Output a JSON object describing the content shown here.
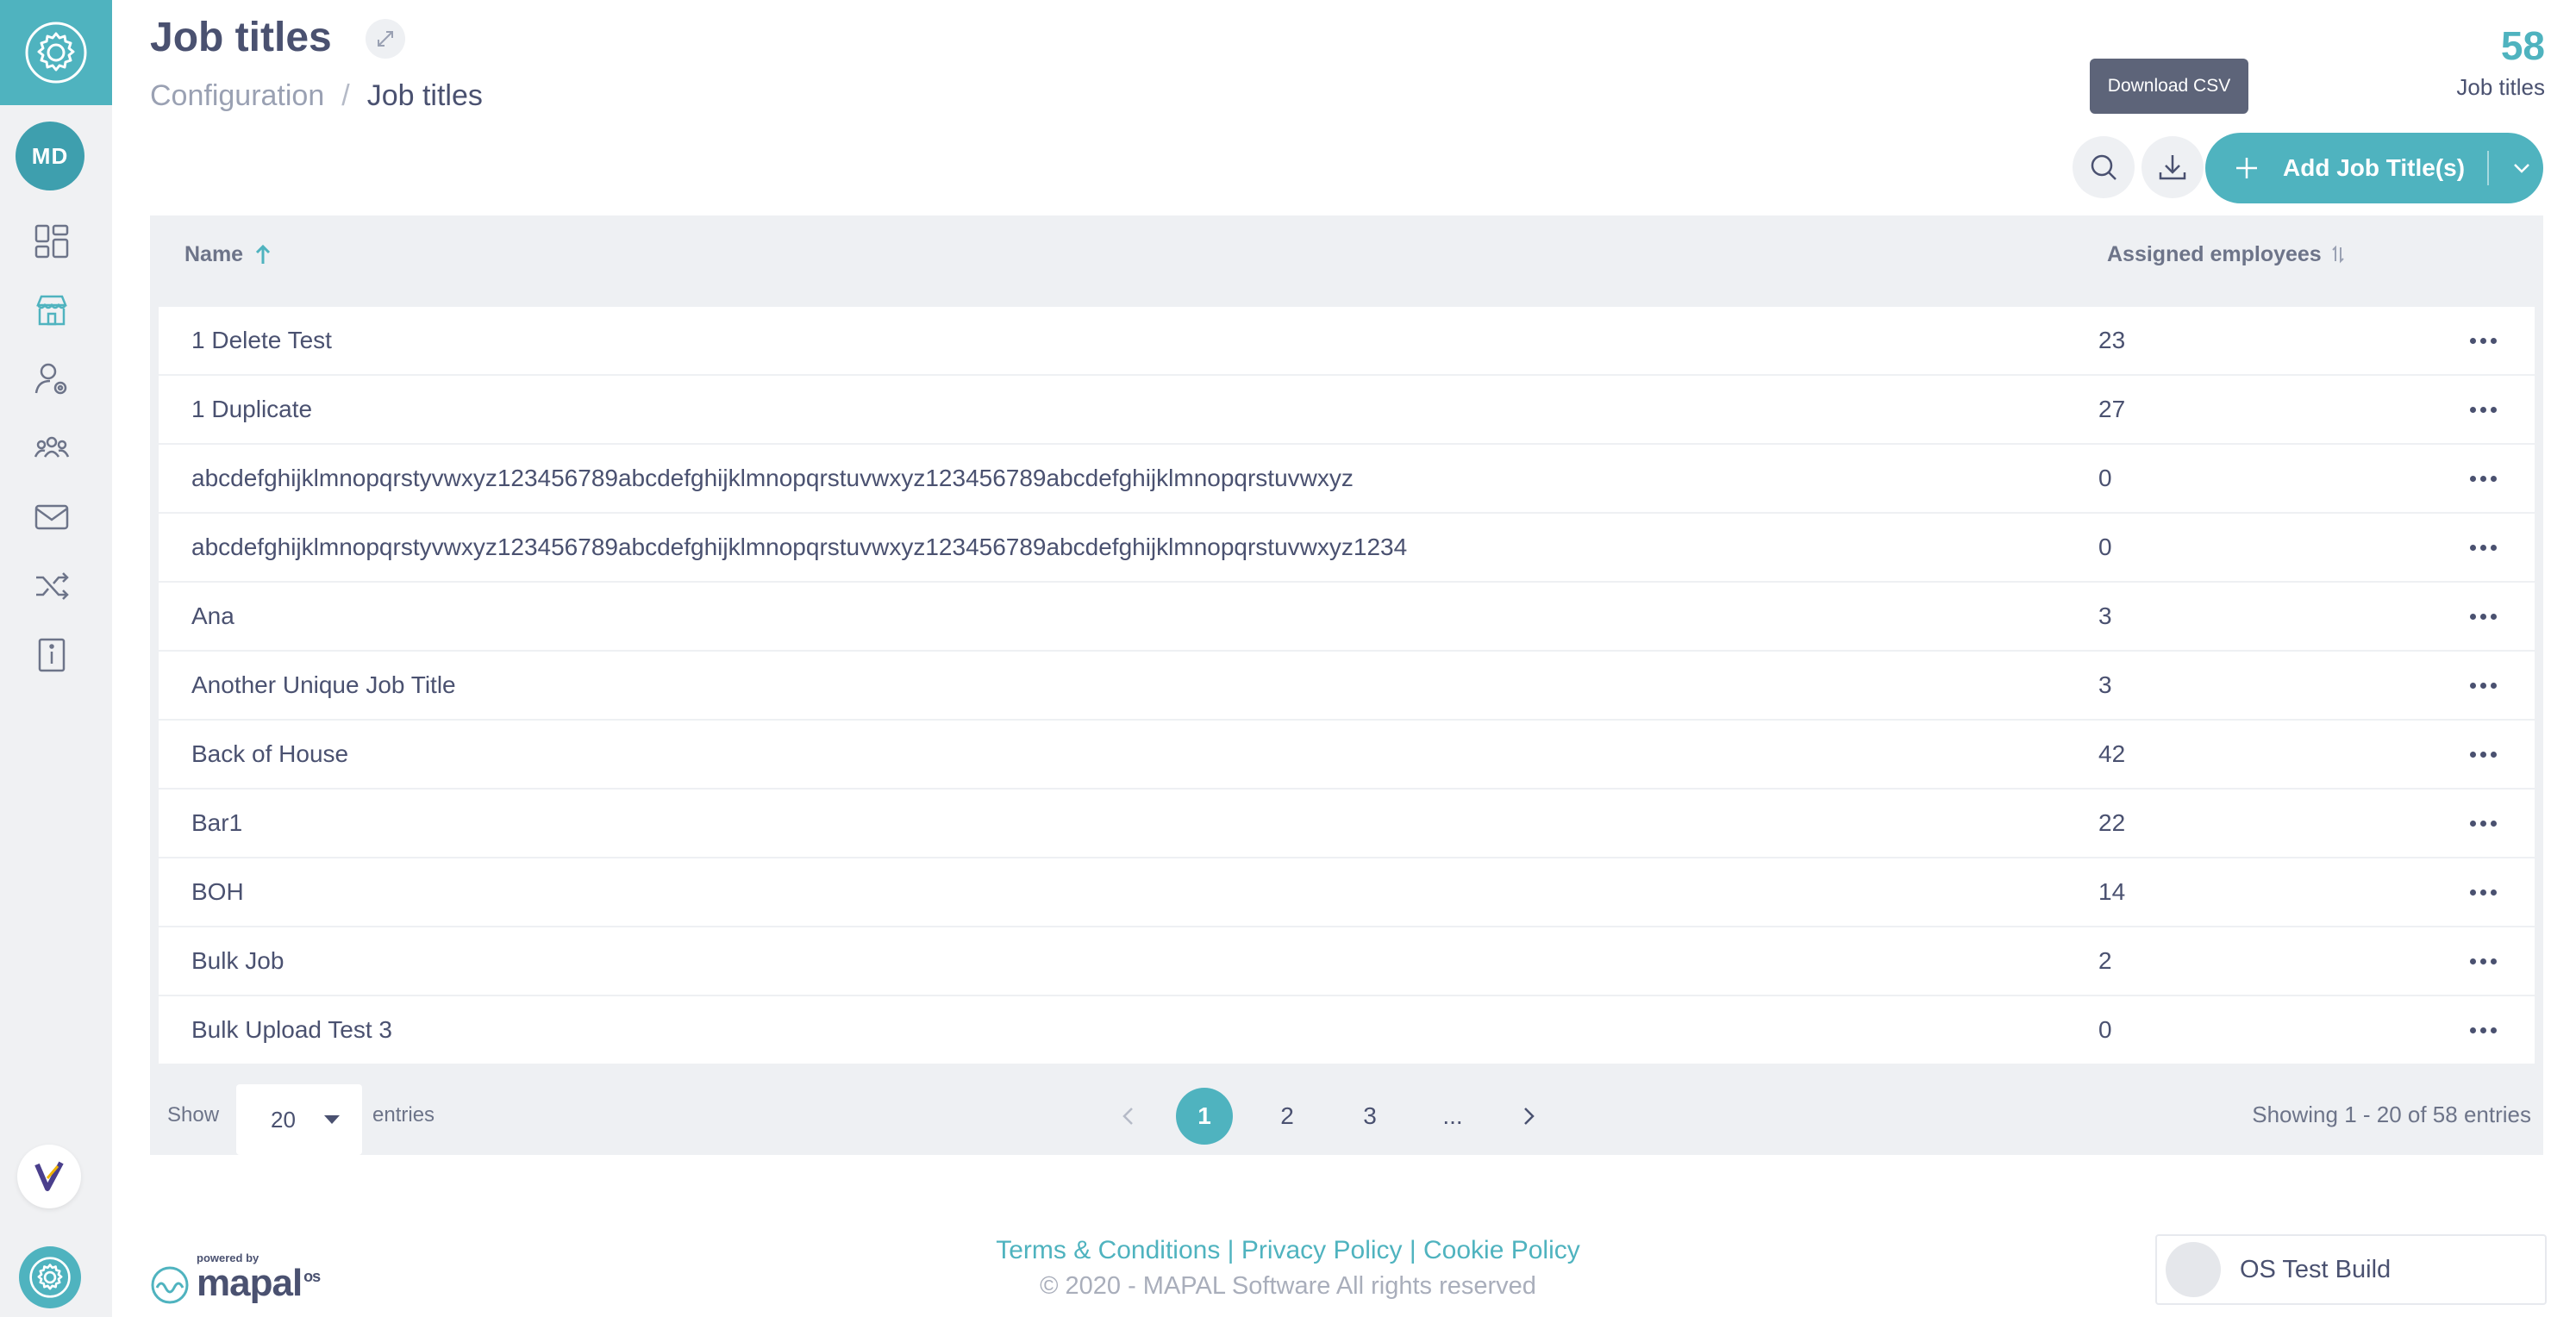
{
  "header": {
    "title": "Job titles",
    "breadcrumb": {
      "parent": "Configuration",
      "separator": "/",
      "current": "Job titles"
    },
    "count": {
      "value": "58",
      "label": "Job titles"
    }
  },
  "sidebar": {
    "avatar_initials": "MD",
    "items": [
      {
        "icon": "dashboard-icon"
      },
      {
        "icon": "store-icon"
      },
      {
        "icon": "user-settings-icon"
      },
      {
        "icon": "team-icon"
      },
      {
        "icon": "mail-icon"
      },
      {
        "icon": "shuffle-icon"
      },
      {
        "icon": "info-icon"
      }
    ]
  },
  "toolbar": {
    "tooltip": "Download CSV",
    "add_label": "Add Job Title(s)"
  },
  "table": {
    "columns": {
      "name": "Name",
      "assigned": "Assigned employees"
    },
    "rows": [
      {
        "name": "1 Delete Test",
        "count": "23"
      },
      {
        "name": "1 Duplicate",
        "count": "27"
      },
      {
        "name": "abcdefghijklmnopqrstyvwxyz123456789abcdefghijklmnopqrstuvwxyz123456789abcdefghijklmnopqrstuvwxyz",
        "count": "0"
      },
      {
        "name": "abcdefghijklmnopqrstyvwxyz123456789abcdefghijklmnopqrstuvwxyz123456789abcdefghijklmnopqrstuvwxyz1234",
        "count": "0"
      },
      {
        "name": "Ana",
        "count": "3"
      },
      {
        "name": "Another Unique Job Title",
        "count": "3"
      },
      {
        "name": "Back of House",
        "count": "42"
      },
      {
        "name": "Bar1",
        "count": "22"
      },
      {
        "name": "BOH",
        "count": "14"
      },
      {
        "name": "Bulk Job",
        "count": "2"
      },
      {
        "name": "Bulk Upload Test 3",
        "count": "0"
      }
    ]
  },
  "pagination": {
    "show_label": "Show",
    "entries_value": "20",
    "entries_label": "entries",
    "pages": [
      "1",
      "2",
      "3",
      "..."
    ],
    "current_page": "1",
    "showing": "Showing 1 - 20 of 58 entries"
  },
  "footer": {
    "powered_by": "powered by",
    "brand": "mapal",
    "brand_suffix": "os",
    "links": [
      "Terms & Conditions",
      "Privacy Policy",
      "Cookie Policy"
    ],
    "link_separator": "|",
    "copyright": "© 2020 - MAPAL Software All rights reserved",
    "build": "OS Test Build"
  },
  "colors": {
    "accent": "#4fb3bf",
    "text": "#4a5170",
    "panel": "#eef0f3"
  }
}
